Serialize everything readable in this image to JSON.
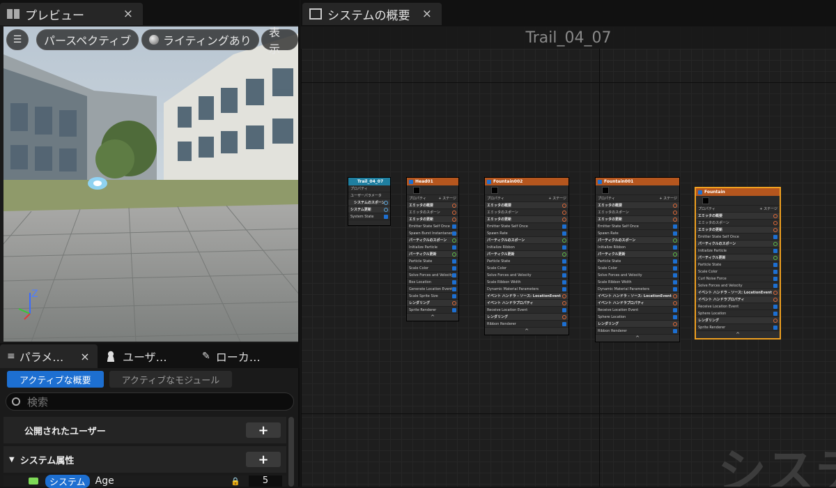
{
  "left": {
    "tab": {
      "label": "プレビュー",
      "close": "×"
    },
    "viewport": {
      "menu": "☰",
      "perspective": "パースペクティブ",
      "lighting": "ライティングあり",
      "show": "表示",
      "axis_z": "Z"
    },
    "panel_tabs": [
      {
        "label": "パラメ…",
        "close": "×"
      },
      {
        "label": "ユーザ…"
      },
      {
        "label": "ローカ…"
      }
    ],
    "subtabs": {
      "active": "アクティブな概要",
      "inactive": "アクティブなモジュール"
    },
    "search": {
      "placeholder": "検索"
    },
    "rows": [
      {
        "label": "公開されたユーザー",
        "button": "+"
      },
      {
        "label": "システム属性",
        "button": "+"
      }
    ],
    "partial_row": {
      "badge": "システム",
      "name": "Age",
      "value": "5"
    }
  },
  "right": {
    "tab": {
      "label": "システムの概要",
      "close": "×"
    },
    "graph_title": "Trail_04_07",
    "watermark": "システ",
    "nodes": {
      "system": {
        "title": "Trail_04_07",
        "rows": [
          "プロパティ",
          "ユーザーパラメータ",
          "システムのスポーン",
          "システム更新",
          "System State"
        ]
      },
      "head": {
        "title": "Head01",
        "stage": "ステージ",
        "rows": [
          "プロパティ",
          "エミッタの概要",
          "エミッタのスポーン",
          "エミッタの更新",
          "Emitter State  Self  Once",
          "Spawn Burst Instantaneous",
          "パーティクルのスポーン",
          "Initialize Particle",
          "パーティクル更新",
          "Particle State",
          "Scale Color",
          "Solve Forces and Velocity",
          "Box Location",
          "Generate Location Event",
          "Scale Sprite Size",
          "レンダリング",
          "Sprite Renderer"
        ]
      },
      "fountain002": {
        "title": "Fountain002",
        "stage": "ステージ",
        "rows": [
          "プロパティ",
          "エミッタの概要",
          "エミッタのスポーン",
          "エミッタの更新",
          "Emitter State  Self  Once",
          "Spawn Rate",
          "パーティクルのスポーン",
          "Initialize Ribbon",
          "パーティクル更新",
          "Particle State",
          "Scale Color",
          "Solve Forces and Velocity",
          "Scale Ribbon Width",
          "Dynamic Material Parameters",
          "イベント ハンドラ - ソース: LocationEvent",
          "イベント ハンドラプロパティ",
          "Receive Location Event",
          "レンダリング",
          "Ribbon Renderer"
        ]
      },
      "fountain001": {
        "title": "Fountain001",
        "stage": "ステージ",
        "rows": [
          "プロパティ",
          "エミッタの概要",
          "エミッタのスポーン",
          "エミッタの更新",
          "Emitter State  Self  Once",
          "Spawn Rate",
          "パーティクルのスポーン",
          "Initialize Ribbon",
          "パーティクル更新",
          "Particle State",
          "Scale Color",
          "Solve Forces and Velocity",
          "Scale Ribbon Width",
          "Dynamic Material Parameters",
          "イベント ハンドラ - ソース: LocationEvent",
          "イベント ハンドラプロパティ",
          "Receive Location Event",
          "Sphere Location",
          "レンダリング",
          "Ribbon Renderer"
        ]
      },
      "fountain": {
        "title": "Fountain",
        "stage": "ステージ",
        "rows": [
          "プロパティ",
          "エミッタの概要",
          "エミッタのスポーン",
          "エミッタの更新",
          "Emitter State  Self  Once",
          "パーティクルのスポーン",
          "Initialize Particle",
          "パーティクル更新",
          "Particle State",
          "Scale Color",
          "Curl Noise Force",
          "Solve Forces and Velocity",
          "イベント ハンドラ - ソース: LocationEvent",
          "イベント ハンドラプロパティ",
          "Receive Location Event",
          "Sphere Location",
          "レンダリング",
          "Sprite Renderer"
        ]
      }
    },
    "footer": "^"
  },
  "colors": {
    "accent_blue": "#1d6fd1",
    "emitter_orange": "#b5561e",
    "system_teal": "#1f7fa0",
    "selected_outline": "#f0a020"
  }
}
